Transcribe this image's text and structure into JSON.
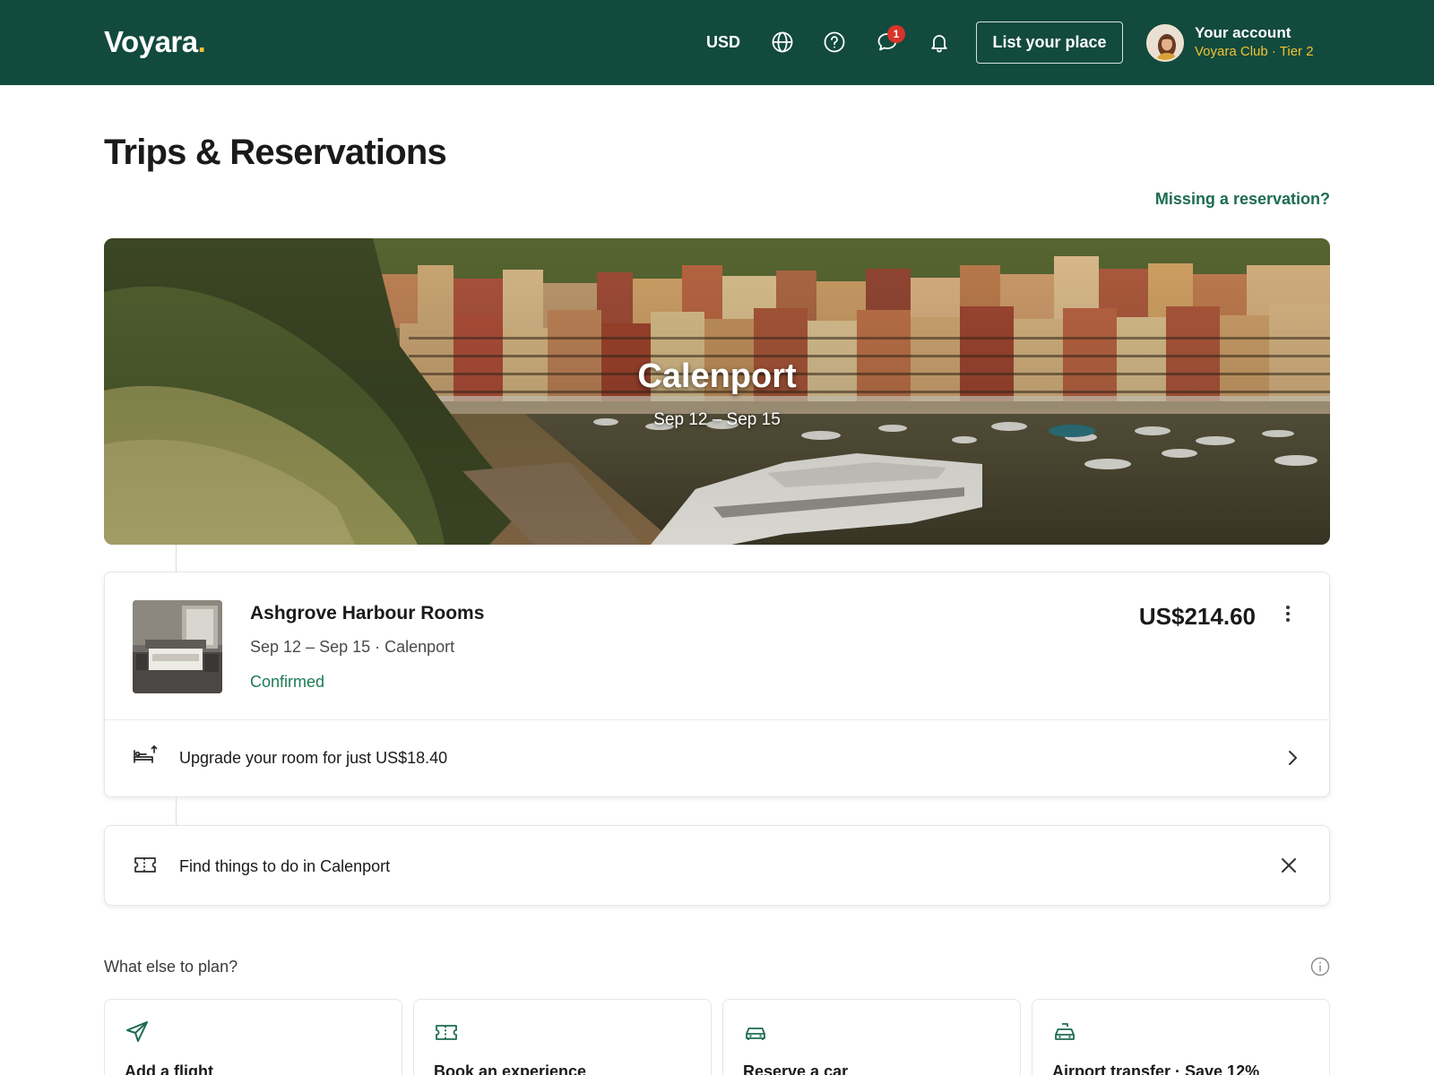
{
  "header": {
    "logo_text": "Voyara",
    "logo_dot": ".",
    "currency": "USD",
    "messages_badge": "1",
    "list_place_label": "List your place",
    "account_title": "Your account",
    "account_subtitle": "Voyara Club · Tier 2",
    "icons": [
      "globe-icon",
      "help-icon",
      "messages-icon",
      "bell-icon"
    ]
  },
  "page": {
    "title": "Trips & Reservations",
    "missing_link": "Missing a reservation?"
  },
  "trip": {
    "city": "Calenport",
    "dates": "Sep 12 – Sep 15"
  },
  "reservation": {
    "name": "Ashgrove Harbour Rooms",
    "details": "Sep 12 – Sep 15 · Calenport",
    "status": "Confirmed",
    "price": "US$214.60",
    "upgrade_text": "Upgrade your room for just US$18.40"
  },
  "todo": {
    "text": "Find things to do in Calenport"
  },
  "plan": {
    "title": "What else to plan?",
    "cards": [
      {
        "label": "Add a flight",
        "icon": "plane-icon"
      },
      {
        "label": "Book an experience",
        "icon": "ticket-icon"
      },
      {
        "label": "Reserve a car",
        "icon": "car-icon"
      },
      {
        "label": "Airport transfer · Save 12%",
        "icon": "taxi-icon"
      }
    ]
  },
  "colors": {
    "header_bg": "#124a3e",
    "brand_accent": "#f2c230",
    "link_green": "#1d6b53",
    "status_green": "#1d7a55",
    "badge_red": "#d8332b"
  }
}
